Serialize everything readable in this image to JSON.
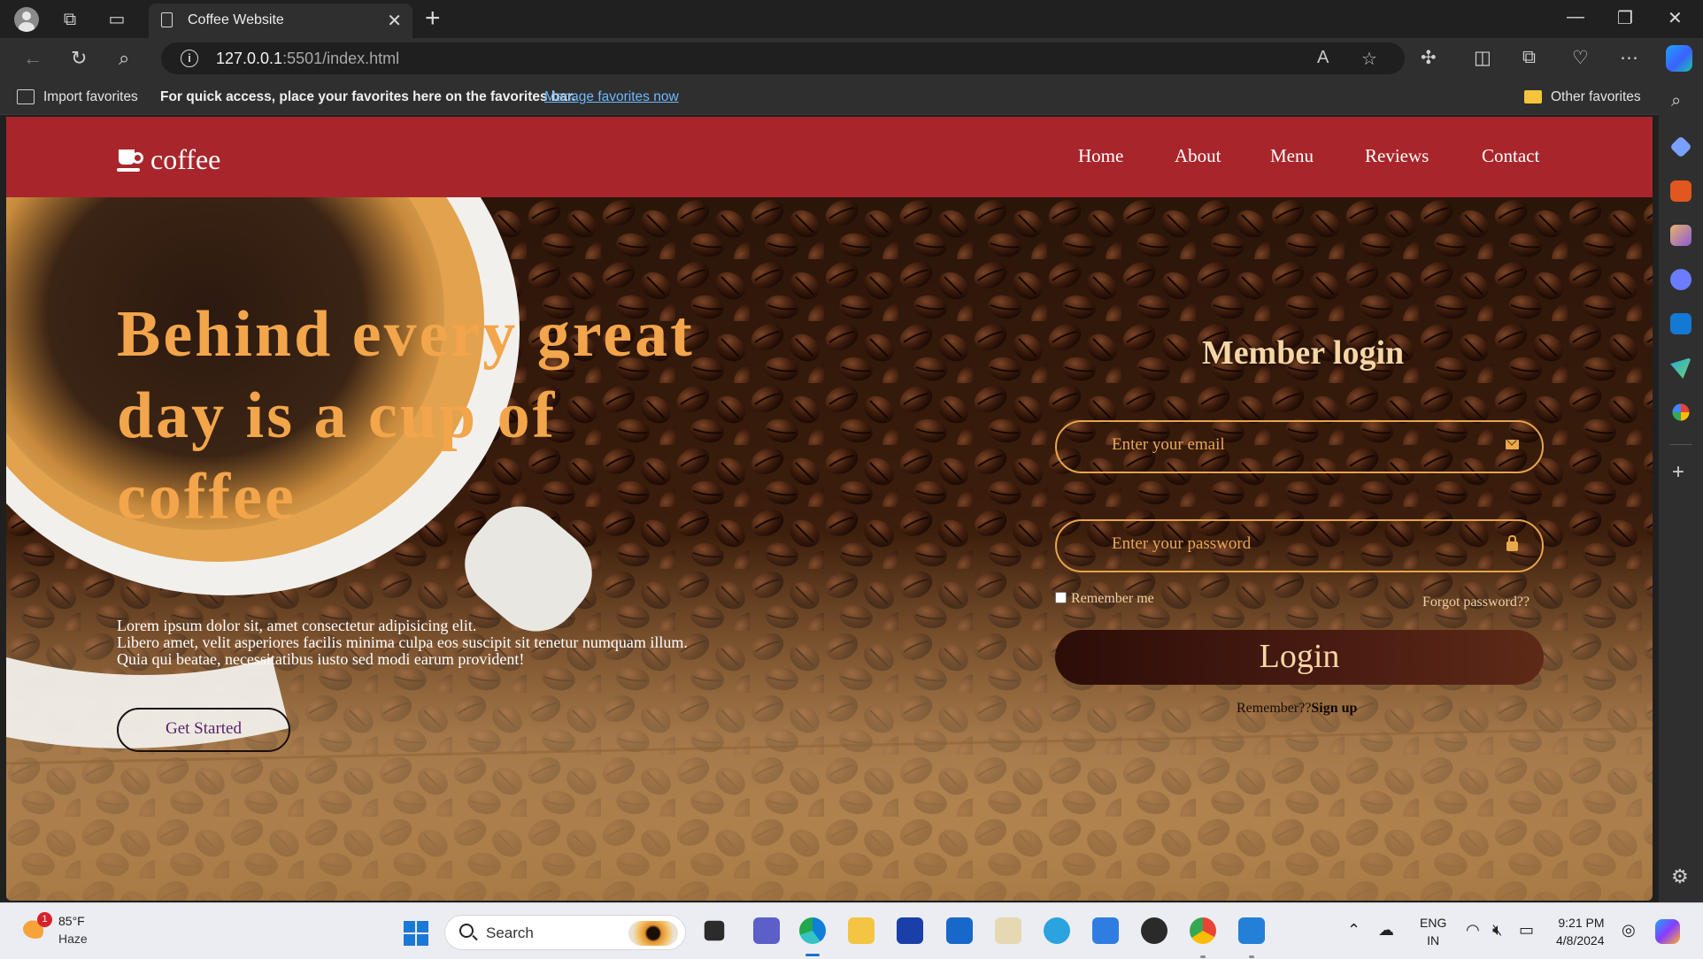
{
  "browser": {
    "tab_title": "Coffee Website",
    "url_host": "127.0.0.1",
    "url_rest": ":5501/index.html",
    "favorites_bar": {
      "import_label": "Import favorites",
      "message": "For quick access, place your favorites here on the favorites bar.",
      "manage_link": "Manage favorites now",
      "other_label": "Other favorites"
    }
  },
  "site": {
    "logo_text": "coffee",
    "nav": [
      "Home",
      "About",
      "Menu",
      "Reviews",
      "Contact"
    ],
    "hero": {
      "headline_line1": "Behind every great",
      "headline_line2": "day is a cup of",
      "headline_line3": "coffee",
      "body_line1": "Lorem ipsum dolor sit, amet consectetur adipisicing elit.",
      "body_line2": "Libero amet, velit asperiores facilis minima culpa eos suscipit sit tenetur numquam illum.",
      "body_line3": "Quia qui beatae, necessitatibus iusto sed modi earum provident!",
      "cta": "Get Started"
    },
    "login": {
      "title": "Member login",
      "email_placeholder": "Enter your email",
      "password_placeholder": "Enter your password",
      "remember": "Remember me",
      "forgot": "Forgot password??",
      "button": "Login",
      "signup_prefix": "Remember??",
      "signup_link": "Sign up"
    },
    "colors": {
      "header_bg": "#a8262b",
      "accent": "#f2a54a",
      "login_button": "#3a130c"
    }
  },
  "taskbar": {
    "weather_badge": "1",
    "weather_temp": "85°F",
    "weather_cond": "Haze",
    "search_label": "Search",
    "lang_line1": "ENG",
    "lang_line2": "IN",
    "time": "9:21 PM",
    "date": "4/8/2024"
  }
}
